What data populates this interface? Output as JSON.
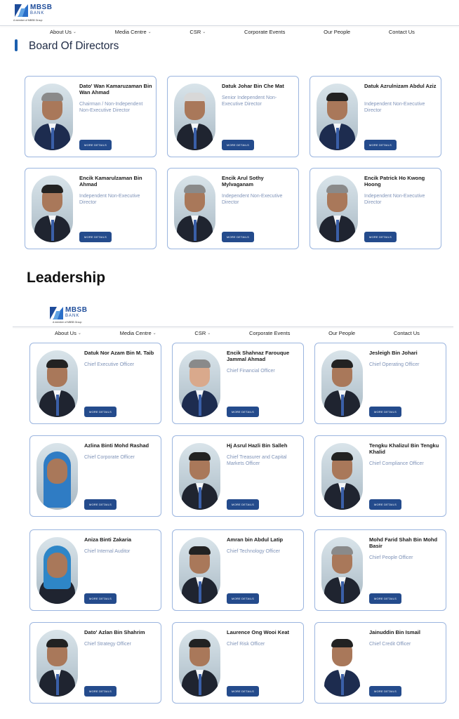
{
  "brand": {
    "name": "MBSB",
    "sub": "BANK",
    "tagline": "A member of MBSB Group"
  },
  "nav": [
    {
      "label": "About Us",
      "chevron": true
    },
    {
      "label": "Media Centre",
      "chevron": true
    },
    {
      "label": "CSR",
      "chevron": true
    },
    {
      "label": "Corporate Events",
      "chevron": false
    },
    {
      "label": "Our People",
      "chevron": false
    },
    {
      "label": "Contact Us",
      "chevron": false
    }
  ],
  "chevron_glyph": "⌄",
  "board_title": "Board Of Directors",
  "leadership_title": "Leadership",
  "button_label": "MORE DETAILS",
  "board": [
    {
      "name": "Dato' Wan Kamaruzaman Bin Wan Ahmad",
      "role": "Chairman / Non-Independent Non-Executive Director"
    },
    {
      "name": "Datuk Johar Bin Che Mat",
      "role": "Senior Independent Non-Executive Director"
    },
    {
      "name": "Datuk Azrulnizam Abdul Aziz",
      "role": "Independent Non-Executive Director"
    },
    {
      "name": "Encik Kamarulzaman Bin Ahmad",
      "role": "Independent Non-Executive Director"
    },
    {
      "name": "Encik Arul Sothy Mylvaganam",
      "role": "Independent Non-Executive Director"
    },
    {
      "name": "Encik Patrick Ho Kwong Hoong",
      "role": "Independent Non-Executive Director"
    }
  ],
  "leadership": [
    {
      "name": "Datuk Nor Azam Bin M. Taib",
      "role": "Chief Executive Officer"
    },
    {
      "name": "Encik Shahnaz Farouque Jammal Ahmad",
      "role": "Chief Financial Officer"
    },
    {
      "name": "Jesleigh Bin Johari",
      "role": "Chief Operating Officer"
    },
    {
      "name": "Azlina Binti Mohd Rashad",
      "role": "Chief Corporate Officer"
    },
    {
      "name": "Hj Asrul Hazli Bin Salleh",
      "role": "Chief Treasurer and Capital Markets Officer"
    },
    {
      "name": "Tengku Khalizul Bin Tengku Khalid",
      "role": "Chief Compliance Officer"
    },
    {
      "name": "Aniza Binti Zakaria",
      "role": "Chief Internal Auditor"
    },
    {
      "name": "Amran bin Abdul Latip",
      "role": "Chief Technology Officer"
    },
    {
      "name": "Mohd Farid Shah Bin Mohd Basir",
      "role": "Chief People Officer"
    },
    {
      "name": "Dato' Azlan Bin Shahrim",
      "role": "Chief Strategy Officer"
    },
    {
      "name": "Laurence Ong Wooi Keat",
      "role": "Chief Risk Officer"
    },
    {
      "name": "Jainuddin Bin Ismail",
      "role": "Chief Credit Officer"
    }
  ],
  "colors": {
    "brand_blue": "#1e4c9a",
    "button": "#244b8c",
    "card_border": "#9bb5df",
    "role_text": "#7f93b8"
  }
}
